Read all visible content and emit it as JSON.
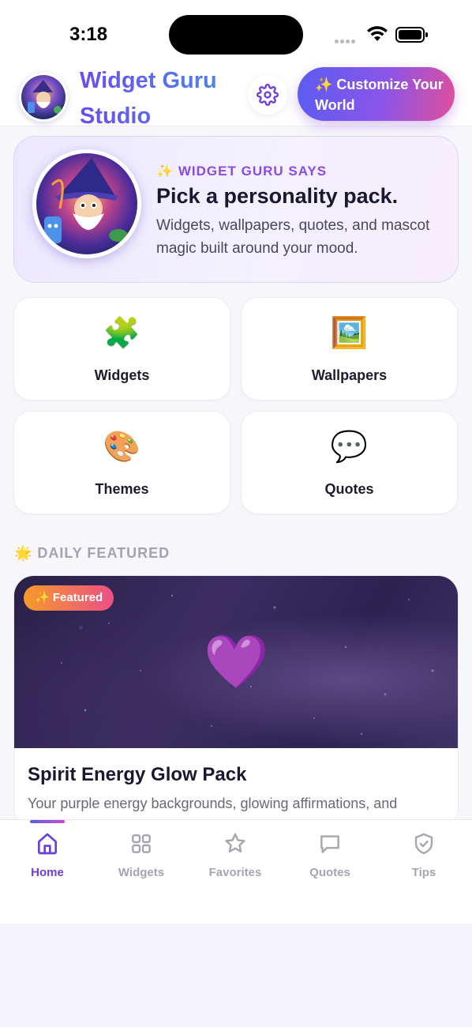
{
  "status_bar": {
    "time": "3:18"
  },
  "header": {
    "app_title": "Widget Guru Studio",
    "customize_button": "✨ Customize Your World"
  },
  "hero": {
    "kicker": "✨ WIDGET GURU SAYS",
    "title": "Pick a personality pack.",
    "subtitle": "Widgets, wallpapers, quotes, and mascot magic built around your mood."
  },
  "categories": [
    {
      "label": "Widgets",
      "icon": "🧩"
    },
    {
      "label": "Wallpapers",
      "icon": "🖼️"
    },
    {
      "label": "Themes",
      "icon": "🎨"
    },
    {
      "label": "Quotes",
      "icon": "💬"
    }
  ],
  "daily_featured": {
    "section_label": "🌟 DAILY FEATURED",
    "badge": "✨ Featured",
    "image_emoji": "💜",
    "title": "Spirit Energy Glow Pack",
    "description": "Your purple energy backgrounds, glowing affirmations, and mystical widget styling."
  },
  "tabs": [
    {
      "label": "Home",
      "icon": "home-icon",
      "active": true
    },
    {
      "label": "Widgets",
      "icon": "grid-icon",
      "active": false
    },
    {
      "label": "Favorites",
      "icon": "star-icon",
      "active": false
    },
    {
      "label": "Quotes",
      "icon": "chat-bubble-icon",
      "active": false
    },
    {
      "label": "Tips",
      "icon": "shield-check-icon",
      "active": false
    }
  ],
  "colors": {
    "accent": "#6b3fd8",
    "gradient_start": "#5b5cf2",
    "gradient_end": "#e04f9a",
    "inactive_tab": "#a6a4b2"
  }
}
